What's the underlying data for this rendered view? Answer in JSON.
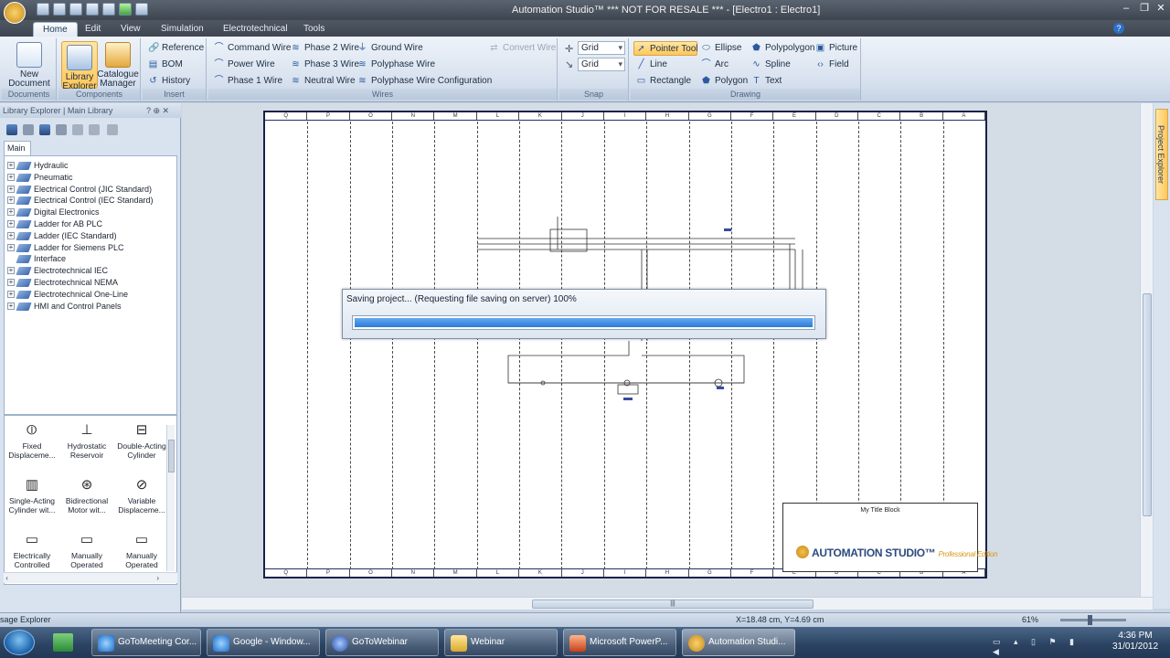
{
  "window": {
    "title": "Automation Studio™   *** NOT FOR RESALE ***    - [Electro1 : Electro1]"
  },
  "ribbon": {
    "tabs": [
      "Home",
      "Edit",
      "View",
      "Simulation",
      "Electrotechnical",
      "Tools"
    ],
    "active_tab": "Home",
    "groups": {
      "documents": {
        "label": "Documents",
        "new_document": "New Document ▾"
      },
      "components": {
        "label": "Components",
        "library_explorer": "Library Explorer",
        "catalogue_manager": "Catalogue Manager"
      },
      "insert": {
        "label": "Insert",
        "reference": "Reference",
        "bom": "BOM",
        "history": "History"
      },
      "wires": {
        "label": "Wires",
        "command_wire": "Command Wire",
        "power_wire": "Power Wire",
        "phase1_wire": "Phase 1 Wire",
        "phase2_wire": "Phase 2 Wire",
        "phase3_wire": "Phase 3 Wire",
        "neutral_wire": "Neutral Wire",
        "ground_wire": "Ground Wire",
        "polyphase_wire": "Polyphase Wire",
        "polyphase_config": "Polyphase Wire Configuration",
        "convert_wire": "Convert Wire"
      },
      "snap": {
        "label": "Snap",
        "grid1": "Grid",
        "grid2": "Grid"
      },
      "drawing": {
        "label": "Drawing",
        "pointer_tool": "Pointer Tool",
        "line": "Line",
        "rectangle": "Rectangle",
        "ellipse": "Ellipse",
        "arc": "Arc",
        "polygon": "Polygon",
        "polypolygon": "Polypolygon",
        "spline": "Spline",
        "text": "Text",
        "picture": "Picture",
        "field": "Field"
      }
    }
  },
  "library": {
    "header": "Library Explorer | Main Library",
    "tab": "Main",
    "tree": [
      "Hydraulic",
      "Pneumatic",
      "Electrical Control (JIC Standard)",
      "Electrical Control (IEC Standard)",
      "Digital Electronics",
      "Ladder for AB PLC",
      "Ladder (IEC Standard)",
      "Ladder for Siemens PLC",
      "Interface",
      "Electrotechnical IEC",
      "Electrotechnical NEMA",
      "Electrotechnical One-Line",
      "HMI and Control Panels"
    ],
    "components": [
      {
        "line1": "Fixed",
        "line2": "Displaceme..."
      },
      {
        "line1": "Hydrostatic",
        "line2": "Reservoir"
      },
      {
        "line1": "Double-Acting",
        "line2": "Cylinder"
      },
      {
        "line1": "Single-Acting",
        "line2": "Cylinder wit..."
      },
      {
        "line1": "Bidirectional",
        "line2": "Motor wit..."
      },
      {
        "line1": "Variable",
        "line2": "Displaceme..."
      },
      {
        "line1": "Electrically",
        "line2": "Controlled"
      },
      {
        "line1": "Manually",
        "line2": "Operated"
      },
      {
        "line1": "Manually",
        "line2": "Operated"
      }
    ]
  },
  "sheet": {
    "columns": [
      "Q",
      "P",
      "O",
      "N",
      "M",
      "L",
      "K",
      "J",
      "I",
      "H",
      "G",
      "F",
      "E",
      "D",
      "C",
      "B",
      "A"
    ],
    "title_block_label": "My Title Block",
    "brand": "AUTOMATION STUDIO™",
    "edition": "Professional Edition"
  },
  "dialog": {
    "message": "Saving project... (Requesting file saving on server)   100%",
    "progress": 1.0
  },
  "project_explorer": {
    "label": "Project Explorer"
  },
  "statusbar": {
    "left": "sage Explorer",
    "coords": "X=18.48 cm, Y=4.69 cm",
    "zoom": "61%"
  },
  "taskbar": {
    "items": [
      "GoToMeeting Cor...",
      "Google - Window...",
      "GoToWebinar",
      "Webinar",
      "Microsoft PowerP...",
      "Automation Studi..."
    ],
    "time": "4:36 PM",
    "date": "31/01/2012"
  },
  "colors": {
    "accent": "#2c7bd8",
    "ribbon_selected": "#ffc75a"
  }
}
